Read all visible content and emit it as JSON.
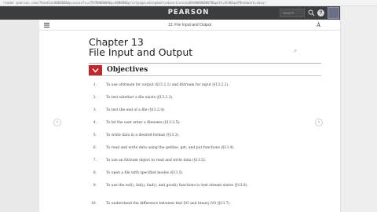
{
  "browser": {
    "url": "reader.pearson.com/?bookId=000000&bp=xxxxx?x=x7070000000&p=000000&printpage=x&segment=x&sectionid=00e0000000070&path=SCHE&pdfBookmark=x&cur"
  },
  "header": {
    "brand": "PEARSON",
    "search_placeholder": "Search",
    "help_label": "?",
    "icons": [
      "search-icon",
      "help-icon",
      "avatar"
    ]
  },
  "toolbar": {
    "chapter_title": "13. File Input and Output",
    "font_button": "A",
    "icons": [
      "menu-icon",
      "font-size-icon"
    ]
  },
  "content": {
    "chapter_number": "Chapter 13",
    "chapter_name": "File Input and Output",
    "objectives_label": "Objectives",
    "objectives": [
      {
        "num": "1.",
        "text": "To use ofstream for output (§13.2.1) and ifstream for input (§13.2.2)."
      },
      {
        "num": "2.",
        "text": "To test whether a file exists (§13.2.3)."
      },
      {
        "num": "3.",
        "text": "To test the end of a file (§13.2.4)."
      },
      {
        "num": "4.",
        "text": "To let the user enter a filename (§13.2.5)."
      },
      {
        "num": "5.",
        "text": "To write data in a desired format (§13.3)."
      },
      {
        "num": "6.",
        "text": "To read and write data using the getline, get, and put functions (§13.4)."
      },
      {
        "num": "7.",
        "text": "To use an fstream object to read and write data (§13.5)."
      },
      {
        "num": "8.",
        "text": "To open a file with specified modes (§13.5)."
      },
      {
        "num": "9.",
        "text": "To use the eof(), fail(), bad(), and good() functions to test stream states (§13.6)."
      },
      {
        "num": "10.",
        "text": "To understand the difference between text I/O and binary I/O (§13.7)."
      }
    ]
  },
  "navigation": {
    "prev_label": "‹",
    "next_label": "›"
  },
  "colors": {
    "accent": "#c0282d",
    "topbar": "#3c3d3f"
  }
}
